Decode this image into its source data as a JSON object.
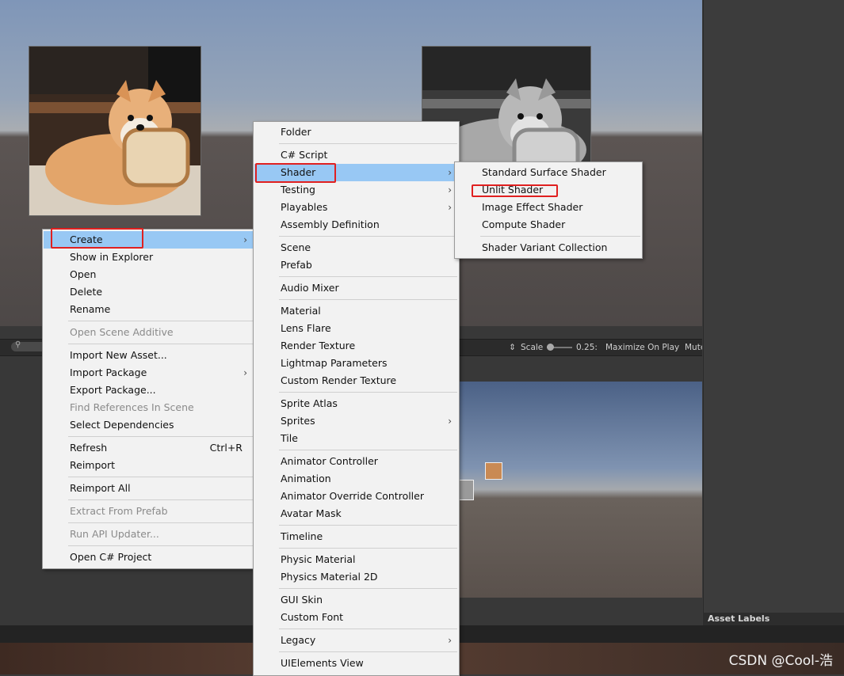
{
  "main_menu": {
    "items": [
      {
        "label": "Create",
        "arrow": "›",
        "highlighted": true
      },
      {
        "label": "Show in Explorer"
      },
      {
        "label": "Open"
      },
      {
        "label": "Delete"
      },
      {
        "label": "Rename"
      },
      {
        "label": "Open Scene Additive",
        "disabled": true
      },
      {
        "label": "Import New Asset..."
      },
      {
        "label": "Import Package",
        "arrow": "›"
      },
      {
        "label": "Export Package..."
      },
      {
        "label": "Find References In Scene",
        "disabled": true
      },
      {
        "label": "Select Dependencies"
      },
      {
        "label": "Refresh",
        "shortcut": "Ctrl+R"
      },
      {
        "label": "Reimport"
      },
      {
        "label": "Reimport All"
      },
      {
        "label": "Extract From Prefab",
        "disabled": true
      },
      {
        "label": "Run API Updater...",
        "disabled": true
      },
      {
        "label": "Open C# Project"
      }
    ]
  },
  "create_menu": {
    "items": [
      {
        "label": "Folder"
      },
      {
        "label": "C# Script"
      },
      {
        "label": "Shader",
        "arrow": "›",
        "highlighted": true
      },
      {
        "label": "Testing",
        "arrow": "›"
      },
      {
        "label": "Playables",
        "arrow": "›"
      },
      {
        "label": "Assembly Definition"
      },
      {
        "label": "Scene"
      },
      {
        "label": "Prefab"
      },
      {
        "label": "Audio Mixer"
      },
      {
        "label": "Material"
      },
      {
        "label": "Lens Flare"
      },
      {
        "label": "Render Texture"
      },
      {
        "label": "Lightmap Parameters"
      },
      {
        "label": "Custom Render Texture"
      },
      {
        "label": "Sprite Atlas"
      },
      {
        "label": "Sprites",
        "arrow": "›"
      },
      {
        "label": "Tile"
      },
      {
        "label": "Animator Controller"
      },
      {
        "label": "Animation"
      },
      {
        "label": "Animator Override Controller"
      },
      {
        "label": "Avatar Mask"
      },
      {
        "label": "Timeline"
      },
      {
        "label": "Physic Material"
      },
      {
        "label": "Physics Material 2D"
      },
      {
        "label": "GUI Skin"
      },
      {
        "label": "Custom Font"
      },
      {
        "label": "Legacy",
        "arrow": "›"
      },
      {
        "label": "UIElements View"
      }
    ]
  },
  "shader_menu": {
    "items": [
      {
        "label": "Standard Surface Shader"
      },
      {
        "label": "Unlit Shader"
      },
      {
        "label": "Image Effect Shader"
      },
      {
        "label": "Compute Shader"
      },
      {
        "label": "Shader Variant Collection"
      }
    ]
  },
  "game_toolbar": {
    "scale_label": "Scale",
    "scale_value": "0.25:",
    "maximize_label": "Maximize On Play",
    "mute_label": "Mute"
  },
  "asset_labels": "Asset Labels",
  "watermark": "CSDN @Cool-浩",
  "colors": {
    "highlight": "#98c8f4",
    "annotation_red": "#e02020",
    "menu_bg": "#f2f2f2"
  }
}
